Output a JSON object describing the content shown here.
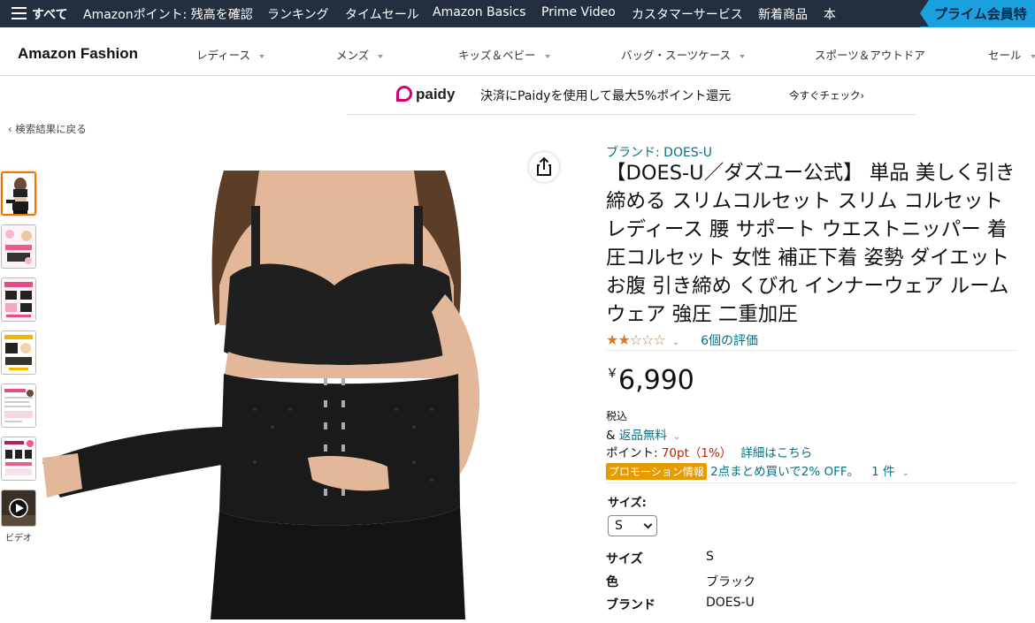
{
  "topnav": {
    "all_label": "すべて",
    "items": [
      "Amazonポイント: 残高を確認",
      "ランキング",
      "タイムセール",
      "Amazon Basics",
      "Prime Video",
      "カスタマーサービス",
      "新着商品",
      "本"
    ],
    "prime_banner": "プライム会員特"
  },
  "fashion_nav": {
    "brand": "Amazon Fashion",
    "categories": [
      "レディース",
      "メンズ",
      "キッズ＆ベビー",
      "バッグ・スーツケース",
      "スポーツ＆アウトドア",
      "セール"
    ]
  },
  "paidy": {
    "logo": "paidy",
    "message": "決済にPaidyを使用して最大5%ポイント還元",
    "cta": "今すぐチェック›"
  },
  "back_link": "‹ 検索結果に戻る",
  "thumbnails": {
    "video_label": "ビデオ"
  },
  "product": {
    "brand_link": "ブランド: DOES-U",
    "title": "【DOES-U／ダズユー公式】 単品 美しく引き締める スリムコルセット スリム コルセット レディース 腰 サポート ウエストニッパー 着圧コルセット 女性 補正下着 姿勢 ダイエット お腹 引き締め くびれ インナーウェア ルームウェア 強圧 二重加圧",
    "stars_text": "★★☆☆☆",
    "rating": 2.0,
    "rating_count": "6個の評価",
    "currency": "￥",
    "price": "6,990",
    "tax": "税込",
    "returns_prefix": "& ",
    "returns": "返品無料",
    "points_label": "ポイント: ",
    "points_value": "70pt（1%）",
    "points_link": "詳細はこちら",
    "promo_badge": "プロモーション情報",
    "promo_text": "2点まとめ買いで2% OFF。",
    "promo_count": "1 件",
    "size_label": "サイズ:",
    "size_selected": "S",
    "specs": [
      {
        "key": "サイズ",
        "value": "S"
      },
      {
        "key": "色",
        "value": "ブラック"
      },
      {
        "key": "ブランド",
        "value": "DOES-U"
      }
    ]
  },
  "colors": {
    "nav_bg": "#232f3e",
    "link": "#007185",
    "price_red": "#b12704",
    "star": "#de7921",
    "promo": "#e69b00",
    "prime": "#1ba0e0"
  }
}
